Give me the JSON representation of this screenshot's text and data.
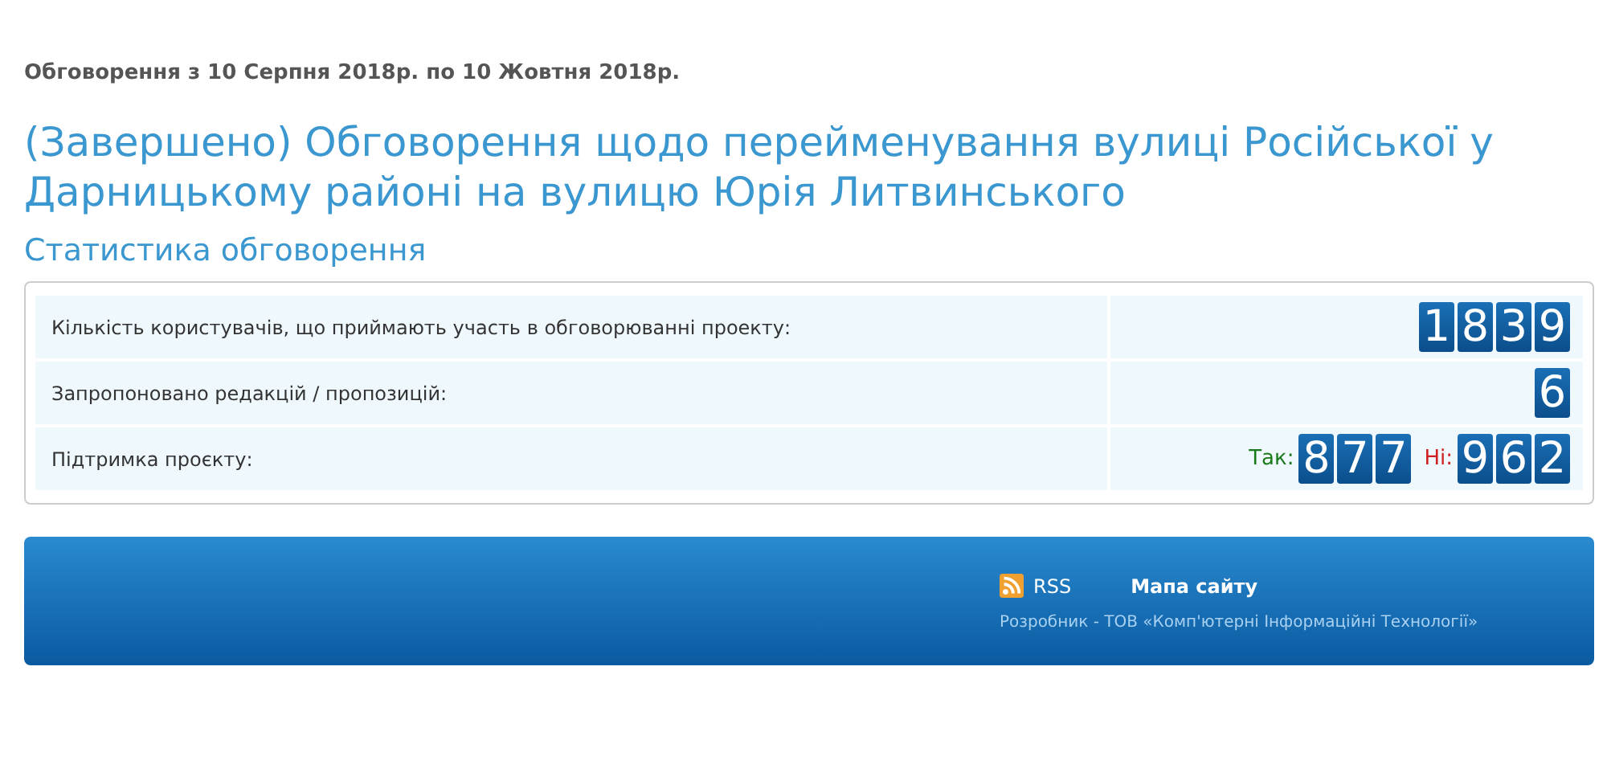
{
  "period": "Обговорення з 10 Серпня 2018р. по 10 Жовтня 2018р.",
  "title": "(Завершено) Обговорення щодо перейменування вулиці Російської у Дарницькому районі на вулицю Юрія Литвинського",
  "stats_heading": "Статистика обговорення",
  "stats": [
    {
      "kind": "counter",
      "label": "Кількість користувачів, що приймають участь в обговорюванні проекту:",
      "value": "1839"
    },
    {
      "kind": "counter",
      "label": "Запропоновано редакцій / пропозицій:",
      "value": "6"
    },
    {
      "kind": "vote",
      "label": "Підтримка проєкту:",
      "yes_label": "Так:",
      "yes": "877",
      "no_label": "Ні:",
      "no": "962"
    }
  ],
  "footer": {
    "rss": "RSS",
    "sitemap": "Мапа сайту",
    "developer": "Розробник - ТОВ «Комп'ютерні Інформаційні Технології»"
  }
}
